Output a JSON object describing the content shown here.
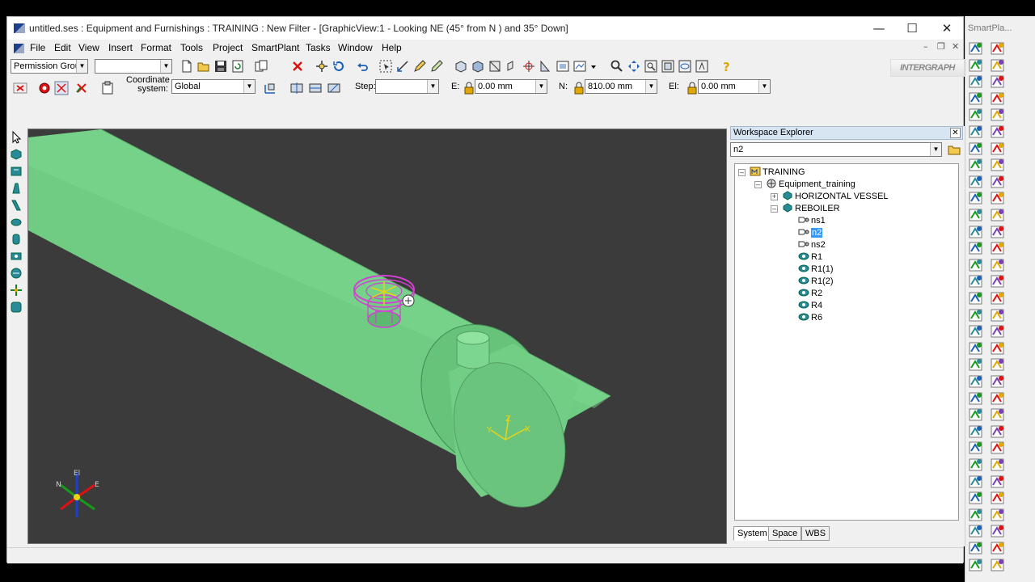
{
  "window": {
    "title": "untitled.ses : Equipment and Furnishings : TRAINING : New Filter - [GraphicView:1 - Looking NE (45° from N ) and 35° Down]",
    "minimize": "—",
    "maximize": "☐",
    "close": "✕"
  },
  "menu": [
    "File",
    "Edit",
    "View",
    "Insert",
    "Format",
    "Tools",
    "Project",
    "SmartPlant",
    "Tasks",
    "Window",
    "Help"
  ],
  "toolbar": {
    "permission_group": "Permission Group",
    "second_combo": "",
    "brand": "INTERGRAPH"
  },
  "ribbon": {
    "coordinate_label": "Coordinate system:",
    "coordinate_value": "Global",
    "step_label": "Step:",
    "step_value": "",
    "e_label": "E:",
    "e_value": "0.00 mm",
    "n_label": "N:",
    "n_value": "810.00 mm",
    "el_label": "El:",
    "el_value": "0.00 mm"
  },
  "viewport": {
    "compass": {
      "el": "El",
      "n": "N",
      "e": "E"
    },
    "axis": {
      "x": "X",
      "y": "Y",
      "z": "Z"
    }
  },
  "explorer": {
    "title": "Workspace Explorer",
    "filter": "n2",
    "tree": {
      "root": "TRAINING",
      "system": "Equipment_training",
      "vessel": "HORIZONTAL VESSEL",
      "reboiler": "REBOILER",
      "children": [
        "ns1",
        "n2",
        "ns2",
        "R1",
        "R1(1)",
        "R1(2)",
        "R2",
        "R4",
        "R6"
      ]
    },
    "tabs": [
      "System",
      "Space",
      "WBS"
    ]
  },
  "right_panel": {
    "title": "SmartPla..."
  },
  "colors": {
    "viewport_bg": "#3b3b3b",
    "equipment_green": "#6fcc82",
    "nozzle_highlight": "#d43fd4",
    "axis_yellow": "#e8d414",
    "selection": "#3399ff"
  }
}
